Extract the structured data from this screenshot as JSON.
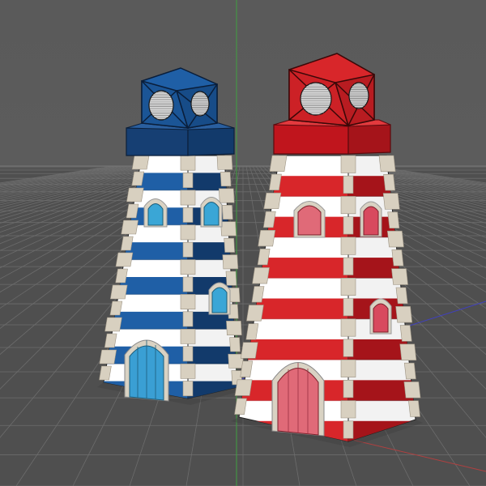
{
  "viewport": {
    "kind": "3d-perspective-view",
    "background_color": "#5b5b5b",
    "ground_color": "#4f4f4f",
    "grid_color": "#6c6c6c",
    "axis_colors": {
      "x": "#b04040",
      "y": "#3fa040",
      "z": "#4040c0"
    }
  },
  "objects": [
    {
      "id": "blue-lighthouse",
      "primary_color": "#1f5fa6",
      "dark_color": "#123a6b",
      "window_color": "#3aa6d6",
      "door_color": "#3a9fd4"
    },
    {
      "id": "red-lighthouse",
      "primary_color": "#d8262a",
      "dark_color": "#a5141a",
      "window_color": "#e06a78",
      "door_color": "#e06a78"
    }
  ]
}
